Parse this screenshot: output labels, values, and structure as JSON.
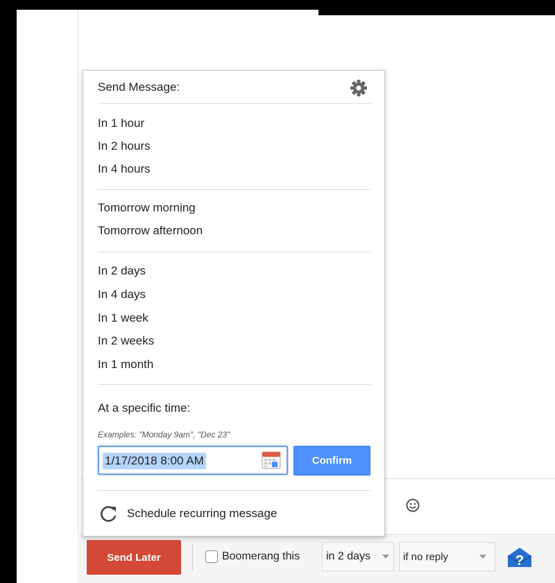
{
  "popup": {
    "title": "Send Message:",
    "groups": [
      [
        "In 1 hour",
        "In 2 hours",
        "In 4 hours"
      ],
      [
        "Tomorrow morning",
        "Tomorrow afternoon"
      ],
      [
        "In 2 days",
        "In 4 days",
        "In 1 week",
        "In 2 weeks",
        "In 1 month"
      ]
    ],
    "specific_label": "At a specific time:",
    "examples": "Examples: \"Monday 9am\", \"Dec 23\"",
    "date_value": "1/17/2018 8:00 AM",
    "confirm_label": "Confirm",
    "recurring_label": "Schedule recurring message"
  },
  "bottom_bar": {
    "send_later_label": "Send Later",
    "boomerang_label": "Boomerang this",
    "when_select": "in 2 days",
    "condition_select": "if no reply"
  },
  "colors": {
    "send_later": "#d34836",
    "confirm": "#4d90fe",
    "help": "#2a6fcf"
  },
  "icons": [
    "gear-icon",
    "calendar-icon",
    "refresh-icon",
    "emoji-icon",
    "help-icon",
    "checkbox"
  ]
}
